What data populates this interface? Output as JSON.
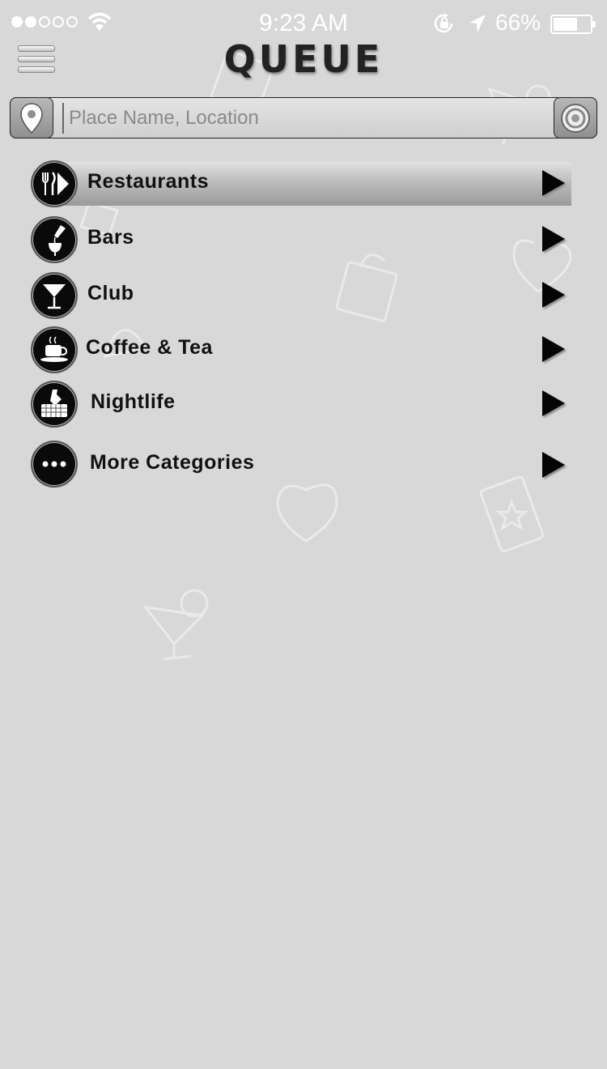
{
  "status_bar": {
    "time": "9:23 AM",
    "battery_percent": "66%",
    "signal_bars_filled": 2,
    "signal_bars_total": 5,
    "battery_level": 0.66
  },
  "header": {
    "title": "QUEUE"
  },
  "search": {
    "placeholder": "Place Name, Location",
    "value": ""
  },
  "categories": [
    {
      "label": "Restaurants",
      "icon": "utensils-icon",
      "selected": true
    },
    {
      "label": "Bars",
      "icon": "wine-pour-icon",
      "selected": false
    },
    {
      "label": "Club",
      "icon": "martini-icon",
      "selected": false
    },
    {
      "label": "Coffee & Tea",
      "icon": "coffee-cup-icon",
      "selected": false
    },
    {
      "label": "Nightlife",
      "icon": "champagne-bucket-icon",
      "selected": false
    },
    {
      "label": "More Categories",
      "icon": "more-dots-icon",
      "selected": false
    }
  ],
  "colors": {
    "background": "#d8d8d8",
    "icon_circle": "#0a0a0a",
    "text": "#111111",
    "status_text": "#ffffff"
  }
}
